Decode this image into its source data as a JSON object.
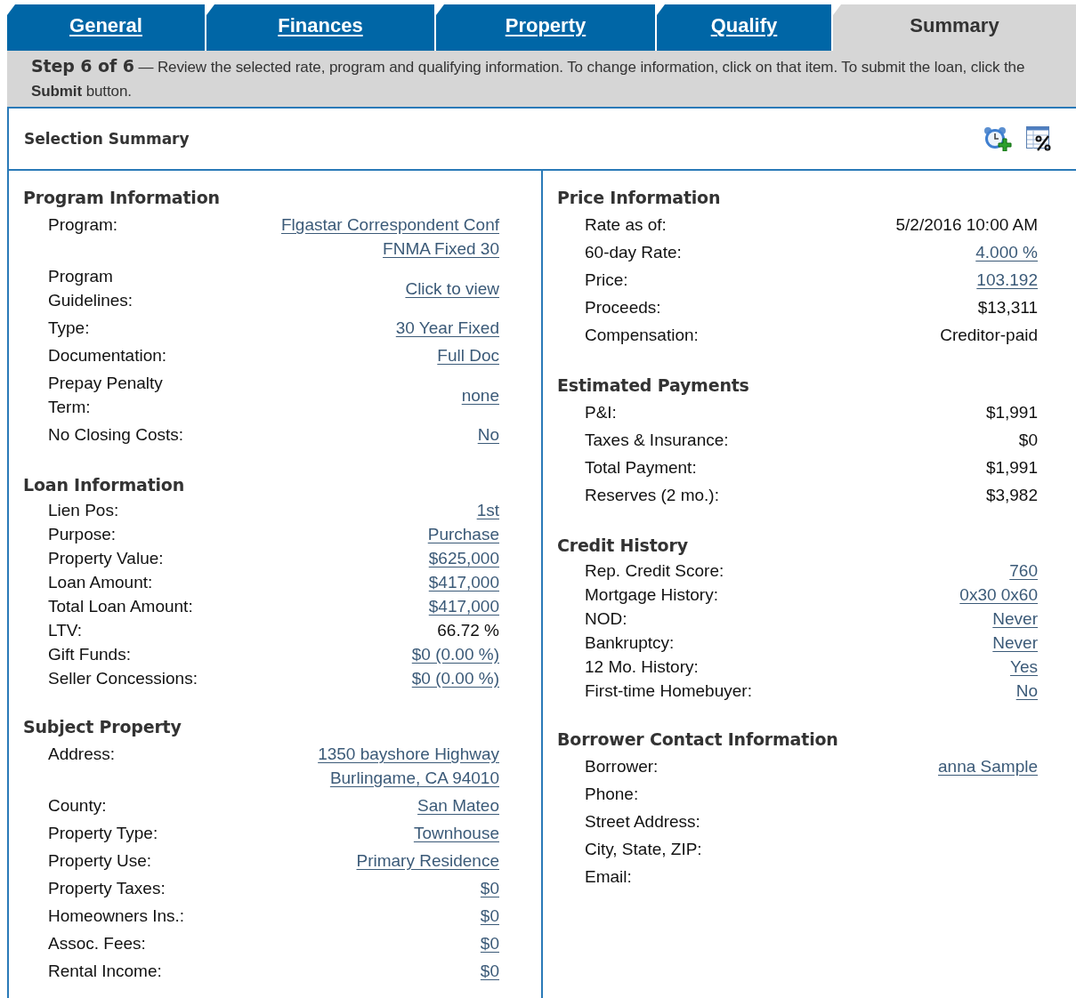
{
  "tabs": [
    {
      "label": "General",
      "selected": false
    },
    {
      "label": "Finances",
      "selected": false
    },
    {
      "label": "Property",
      "selected": false
    },
    {
      "label": "Qualify",
      "selected": false
    },
    {
      "label": "Summary",
      "selected": true
    }
  ],
  "instructions": "**Step 6 of 6** — Review the selected rate, program and qualifying information. To change information, click on that item. To submit the loan, click the **Submit** button.",
  "panel": {
    "title": "Selection Summary",
    "columns": [
      {
        "sections": [
          {
            "title": "Program Information",
            "rows": [
              {
                "label": [
                  "Program:"
                ],
                "kind": "link",
                "values": [
                  "Flgastar Correspondent Conf",
                  "FNMA Fixed 30"
                ]
              },
              {
                "label": [
                  "Program",
                  "Guidelines:"
                ],
                "kind": "link",
                "values": [
                  "Click to view"
                ]
              },
              {
                "label": [
                  "Type:"
                ],
                "kind": "link",
                "values": [
                  "30 Year Fixed"
                ]
              },
              {
                "label": [
                  "Documentation:"
                ],
                "kind": "link",
                "values": [
                  "Full Doc"
                ]
              },
              {
                "label": [
                  "Prepay Penalty",
                  "Term:"
                ],
                "kind": "link",
                "values": [
                  "none"
                ]
              },
              {
                "label": [
                  "No Closing Costs:"
                ],
                "kind": "link",
                "values": [
                  "No"
                ]
              }
            ]
          },
          {
            "title": "Loan Information",
            "rows": [
              {
                "label": [
                  "Lien Pos:"
                ],
                "kind": "link",
                "values": [
                  "1st"
                ]
              },
              {
                "label": [
                  "Purpose:"
                ],
                "kind": "link",
                "values": [
                  "Purchase"
                ]
              },
              {
                "label": [
                  "Property Value:"
                ],
                "kind": "link",
                "values": [
                  "$625,000"
                ]
              },
              {
                "label": [
                  "Loan Amount:"
                ],
                "kind": "link",
                "values": [
                  "$417,000"
                ]
              },
              {
                "label": [
                  "Total Loan Amount:"
                ],
                "kind": "link",
                "values": [
                  "$417,000"
                ]
              },
              {
                "label": [
                  "LTV:"
                ],
                "kind": "text",
                "values": [
                  "66.72 %"
                ]
              },
              {
                "label": [
                  "Gift Funds:"
                ],
                "kind": "link",
                "values": [
                  "$0 (0.00 %)"
                ]
              },
              {
                "label": [
                  "Seller Concessions:"
                ],
                "kind": "link",
                "values": [
                  "$0 (0.00 %)"
                ]
              }
            ]
          },
          {
            "title": "Subject Property",
            "rows": [
              {
                "label": [
                  "Address:"
                ],
                "kind": "link",
                "values": [
                  "1350 bayshore Highway",
                  "Burlingame, CA 94010"
                ]
              },
              {
                "label": [
                  "County:"
                ],
                "kind": "link",
                "values": [
                  "San Mateo"
                ]
              },
              {
                "label": [
                  "Property Type:"
                ],
                "kind": "link",
                "values": [
                  "Townhouse"
                ]
              },
              {
                "label": [
                  "Property Use:"
                ],
                "kind": "link",
                "values": [
                  "Primary Residence"
                ]
              },
              {
                "label": [
                  "Property Taxes:"
                ],
                "kind": "link",
                "values": [
                  "$0"
                ]
              },
              {
                "label": [
                  "Homeowners Ins.:"
                ],
                "kind": "link",
                "values": [
                  "$0"
                ]
              },
              {
                "label": [
                  "Assoc. Fees:"
                ],
                "kind": "link",
                "values": [
                  "$0"
                ]
              },
              {
                "label": [
                  "Rental Income:"
                ],
                "kind": "link",
                "values": [
                  "$0"
                ]
              }
            ]
          }
        ]
      },
      {
        "sections": [
          {
            "title": "Price Information",
            "rows": [
              {
                "label": [
                  "Rate as of:"
                ],
                "kind": "text",
                "values": [
                  "5/2/2016 10:00 AM"
                ]
              },
              {
                "label": [
                  "60-day Rate:"
                ],
                "kind": "link",
                "values": [
                  "4.000 %"
                ]
              },
              {
                "label": [
                  "Price:"
                ],
                "kind": "link",
                "values": [
                  "103.192"
                ]
              },
              {
                "label": [
                  "Proceeds:"
                ],
                "kind": "text",
                "values": [
                  "$13,311"
                ]
              },
              {
                "label": [
                  "Compensation:"
                ],
                "kind": "text",
                "values": [
                  "Creditor-paid"
                ]
              }
            ]
          },
          {
            "title": "Estimated Payments",
            "rows": [
              {
                "label": [
                  "P&I:"
                ],
                "kind": "text",
                "values": [
                  "$1,991"
                ]
              },
              {
                "label": [
                  "Taxes & Insurance:"
                ],
                "kind": "text",
                "values": [
                  "$0"
                ]
              },
              {
                "label": [
                  "Total Payment:"
                ],
                "kind": "text",
                "values": [
                  "$1,991"
                ]
              },
              {
                "label": [
                  "Reserves (2 mo.):"
                ],
                "kind": "text",
                "values": [
                  "$3,982"
                ]
              }
            ]
          },
          {
            "title": "Credit History",
            "rows": [
              {
                "label": [
                  "Rep. Credit Score:"
                ],
                "kind": "link",
                "values": [
                  "760"
                ]
              },
              {
                "label": [
                  "Mortgage History:"
                ],
                "kind": "link",
                "values": [
                  "0x30 0x60"
                ]
              },
              {
                "label": [
                  "NOD:"
                ],
                "kind": "link",
                "values": [
                  "Never"
                ]
              },
              {
                "label": [
                  "Bankruptcy:"
                ],
                "kind": "link",
                "values": [
                  "Never"
                ]
              },
              {
                "label": [
                  "12 Mo. History:"
                ],
                "kind": "link",
                "values": [
                  "Yes"
                ]
              },
              {
                "label": [
                  "First-time Homebuyer:"
                ],
                "kind": "link",
                "values": [
                  "No"
                ]
              }
            ]
          },
          {
            "title": "Borrower Contact Information",
            "rows": [
              {
                "label": [
                  "Borrower:"
                ],
                "kind": "link",
                "values": [
                  "anna Sample"
                ]
              },
              {
                "label": [
                  "Phone:"
                ]
              },
              {
                "label": [
                  "Street Address:"
                ]
              },
              {
                "label": [
                  "City, State, ZIP:"
                ]
              },
              {
                "label": [
                  "Email:"
                ]
              }
            ]
          }
        ]
      }
    ]
  }
}
